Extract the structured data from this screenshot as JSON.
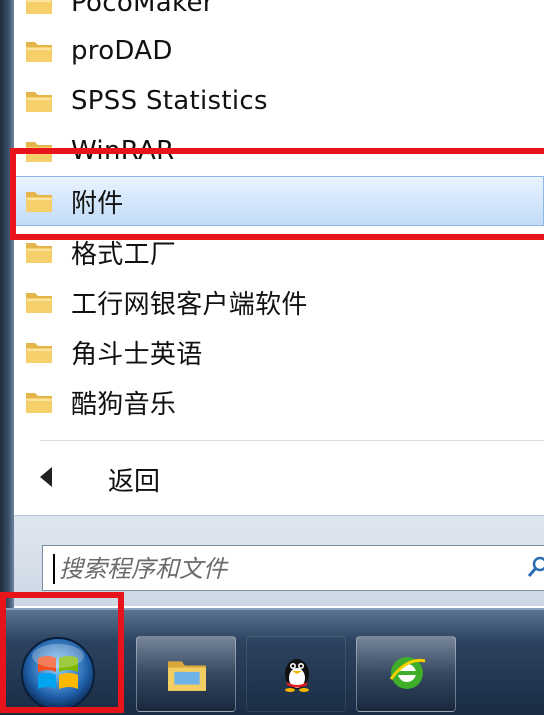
{
  "programs": [
    {
      "label": "PocoMaker"
    },
    {
      "label": "proDAD"
    },
    {
      "label": "SPSS Statistics"
    },
    {
      "label": "WinRAR"
    },
    {
      "label": "附件"
    },
    {
      "label": "格式工厂"
    },
    {
      "label": "工行网银客户端软件"
    },
    {
      "label": "角斗士英语"
    },
    {
      "label": "酷狗音乐"
    }
  ],
  "selected_index": 4,
  "back": {
    "label": "返回"
  },
  "search": {
    "placeholder": "搜索程序和文件"
  },
  "taskbar": {
    "start_icon": "windows-orb",
    "pinned": [
      "explorer-icon",
      "qq-penguin-icon",
      "ie-browser-icon"
    ]
  },
  "colors": {
    "highlight": "#e8141c",
    "selection": "#c2dcf7",
    "taskbar": "#1a2c44"
  }
}
